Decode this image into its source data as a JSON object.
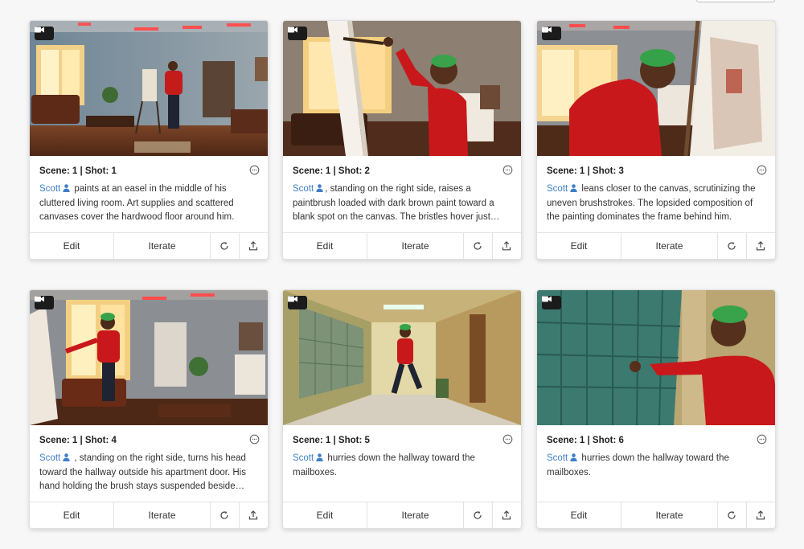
{
  "icons": {
    "camera": "video-camera-icon",
    "chat": "comment-icon",
    "person": "person-icon",
    "refresh": "refresh-icon",
    "share": "upload-icon"
  },
  "colors": {
    "link": "#3f7fc9",
    "badge": "#1b1b1b"
  },
  "cards": [
    {
      "scene": "Scene: 1 | Shot: 1",
      "character": "Scott",
      "description": "paints at an easel in the middle of his cluttered living room. Art supplies and scattered canvases cover the hardwood floor around him.",
      "edit": "Edit",
      "iterate": "Iterate"
    },
    {
      "scene": "Scene: 1 | Shot: 2",
      "character": "Scott",
      "description": ", standing on the right side, raises a paintbrush loaded with dark brown paint toward a blank spot on the canvas. The bristles hover just…",
      "edit": "Edit",
      "iterate": "Iterate"
    },
    {
      "scene": "Scene: 1 | Shot: 3",
      "character": "Scott",
      "description": "leans closer to the canvas, scrutinizing the uneven brushstrokes. The lopsided composition of the painting dominates the frame behind him.",
      "edit": "Edit",
      "iterate": "Iterate"
    },
    {
      "scene": "Scene: 1 | Shot: 4",
      "character": "Scott",
      "description": ", standing on the right side, turns his head toward the hallway outside his apartment door. His hand holding the brush stays suspended beside…",
      "edit": "Edit",
      "iterate": "Iterate"
    },
    {
      "scene": "Scene: 1 | Shot: 5",
      "character": "Scott",
      "description": "hurries down the hallway toward the mailboxes.",
      "edit": "Edit",
      "iterate": "Iterate"
    },
    {
      "scene": "Scene: 1 | Shot: 6",
      "character": "Scott",
      "description": "hurries down the hallway toward the mailboxes.",
      "edit": "Edit",
      "iterate": "Iterate"
    }
  ]
}
